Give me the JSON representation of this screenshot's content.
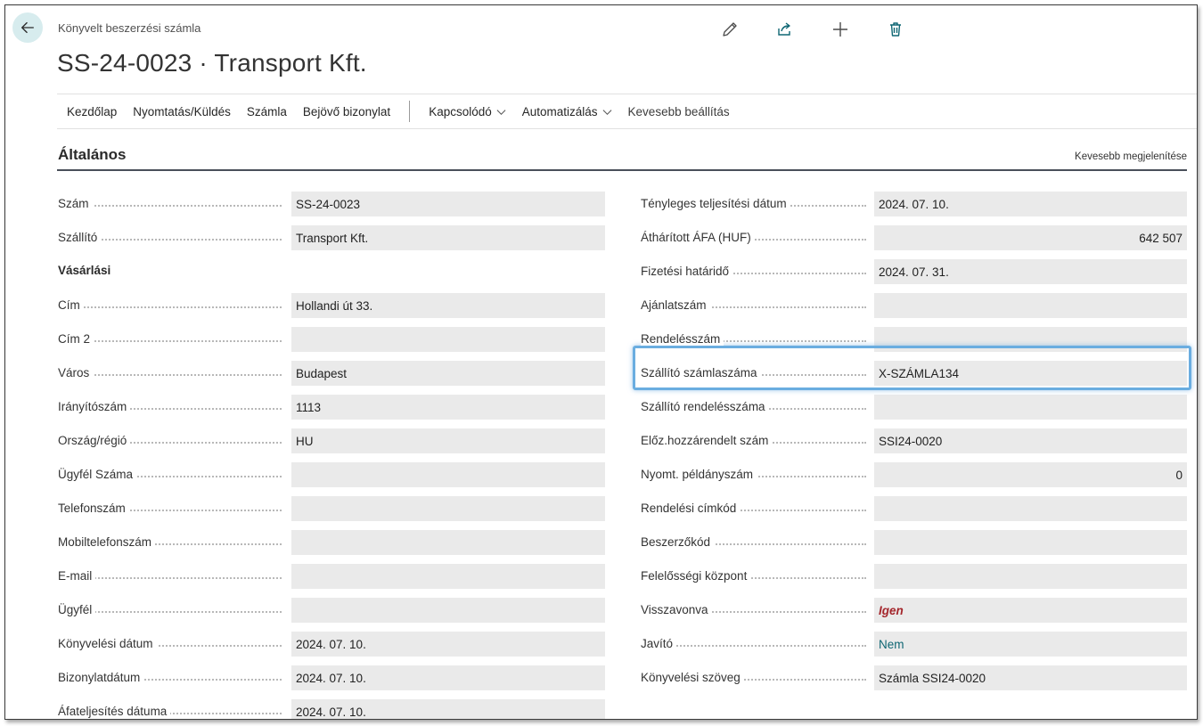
{
  "header": {
    "breadcrumb": "Könyvelt beszerzési számla",
    "title": "SS-24-0023 · Transport Kft."
  },
  "toolbar_icons": [
    "edit-icon",
    "share-icon",
    "add-icon",
    "delete-icon"
  ],
  "menu": {
    "items": [
      "Kezdőlap",
      "Nyomtatás/Küldés",
      "Számla",
      "Bejövő bizonylat"
    ],
    "dropdowns": [
      "Kapcsolódó",
      "Automatizálás"
    ],
    "less": "Kevesebb beállítás"
  },
  "section": {
    "title": "Általános",
    "toggle": "Kevesebb megjelenítése"
  },
  "left": {
    "szam": {
      "label": "Szám",
      "value": "SS-24-0023"
    },
    "szallito": {
      "label": "Szállító",
      "value": "Transport Kft."
    },
    "subheading": "Vásárlási",
    "cim": {
      "label": "Cím",
      "value": "Hollandi út 33."
    },
    "cim2": {
      "label": "Cím 2",
      "value": ""
    },
    "varos": {
      "label": "Város",
      "value": "Budapest"
    },
    "irsz": {
      "label": "Irányítószám",
      "value": "1113"
    },
    "orszag": {
      "label": "Ország/régió",
      "value": "HU"
    },
    "ugyfelszam": {
      "label": "Ügyfél Száma",
      "value": ""
    },
    "telefon": {
      "label": "Telefonszám",
      "value": ""
    },
    "mobil": {
      "label": "Mobiltelefonszám",
      "value": ""
    },
    "email": {
      "label": "E-mail",
      "value": ""
    },
    "ugyfel": {
      "label": "Ügyfél",
      "value": ""
    },
    "konyvdatum": {
      "label": "Könyvelési dátum",
      "value": "2024. 07. 10."
    },
    "bizdatum": {
      "label": "Bizonylatdátum",
      "value": "2024. 07. 10."
    },
    "afadatum": {
      "label": "Áfateljesítés dátuma",
      "value": "2024. 07. 10."
    }
  },
  "right": {
    "teljdatum": {
      "label": "Tényleges teljesítési dátum",
      "value": "2024. 07. 10."
    },
    "athafa": {
      "label": "Áthárított ÁFA (HUF)",
      "value": "642 507"
    },
    "fizhat": {
      "label": "Fizetési határidő",
      "value": "2024. 07. 31."
    },
    "ajanlat": {
      "label": "Ajánlatszám",
      "value": ""
    },
    "rendeles": {
      "label": "Rendelésszám",
      "value": ""
    },
    "szallszamla": {
      "label": "Szállító számlaszáma",
      "value": "X-SZÁMLA134"
    },
    "szallrend": {
      "label": "Szállító rendelésszáma",
      "value": ""
    },
    "elozhozza": {
      "label": "Előz.hozzárendelt szám",
      "value": "SSI24-0020"
    },
    "peldany": {
      "label": "Nyomt. példányszám",
      "value": "0"
    },
    "cimkod": {
      "label": "Rendelési címkód",
      "value": ""
    },
    "beszerzo": {
      "label": "Beszerzőkód",
      "value": ""
    },
    "felelos": {
      "label": "Felelősségi központ",
      "value": ""
    },
    "visszavonva": {
      "label": "Visszavonva",
      "value": "Igen"
    },
    "javito": {
      "label": "Javító",
      "value": "Nem"
    },
    "konyvszoveg": {
      "label": "Könyvelési szöveg",
      "value": "Számla SSI24-0020"
    }
  },
  "colors": {
    "accent_teal": "#0e6673",
    "highlight_blue": "#6aade0",
    "red_value": "#a4262c",
    "field_bg": "#eaeaea"
  }
}
